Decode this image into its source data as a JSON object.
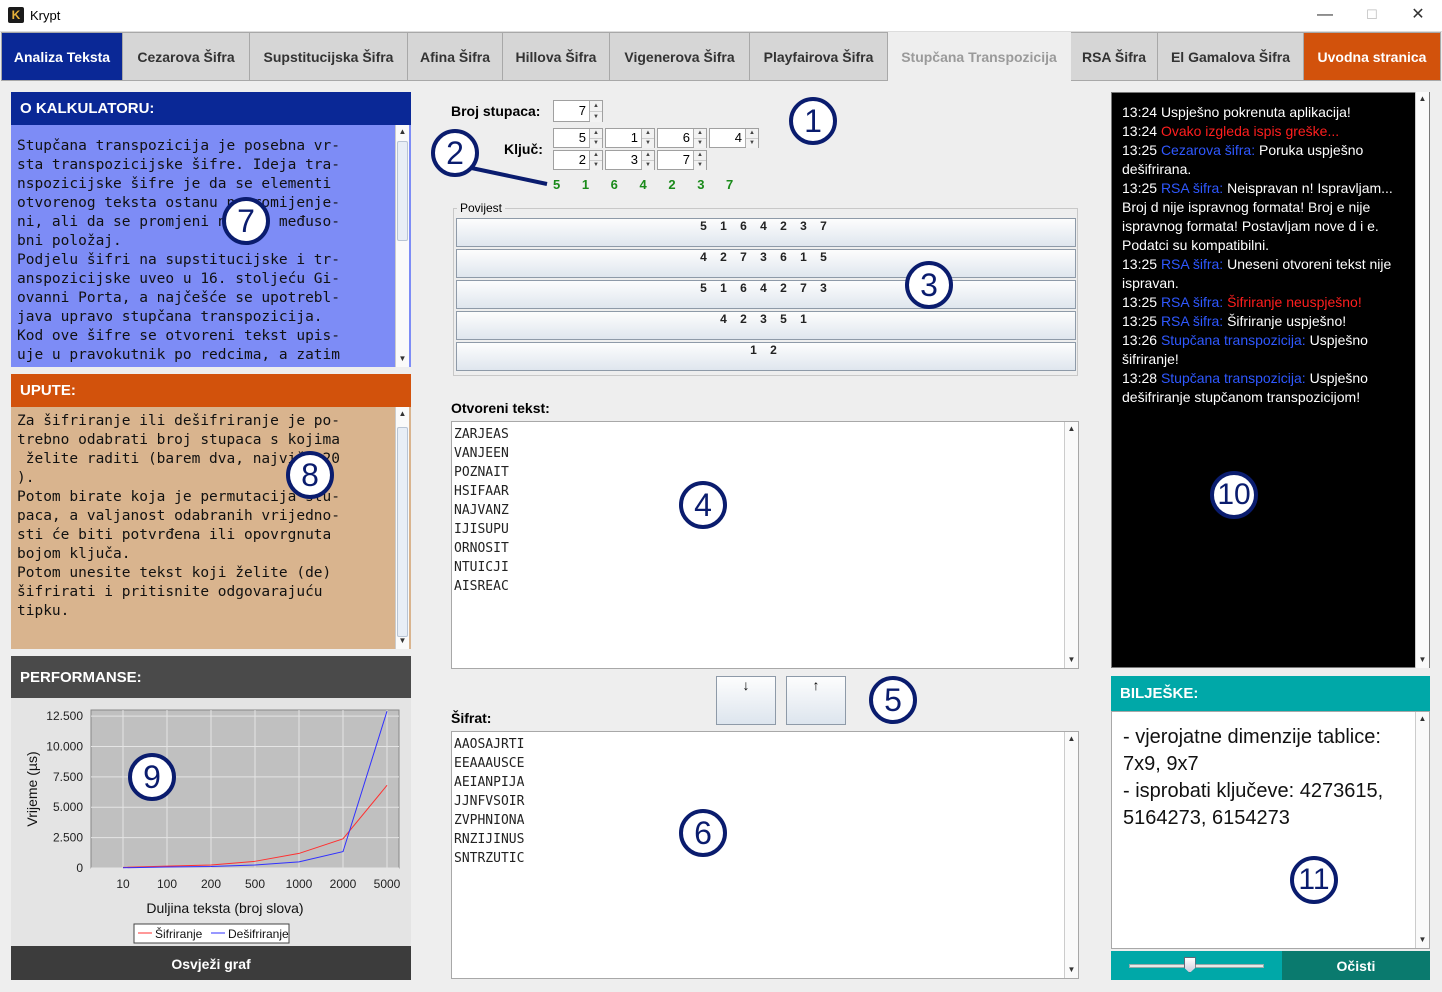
{
  "window": {
    "title": "Krypt",
    "icon_letter": "K",
    "minimize": "—",
    "maximize": "☐",
    "close": "✕"
  },
  "tabs": [
    {
      "label": "Analiza Teksta"
    },
    {
      "label": "Cezarova Šifra"
    },
    {
      "label": "Supstitucijska Šifra"
    },
    {
      "label": "Afina Šifra"
    },
    {
      "label": "Hillova Šifra"
    },
    {
      "label": "Vigenerova Šifra"
    },
    {
      "label": "Playfairova Šifra"
    },
    {
      "label": "Stupčana Transpozicija"
    },
    {
      "label": "RSA Šifra"
    },
    {
      "label": "El Gamalova Šifra"
    },
    {
      "label": "Uvodna stranica"
    }
  ],
  "colors": {
    "tab_first": "#0a2896",
    "tab_last": "#d2520c",
    "about": "#0a2896",
    "about_bg": "#7d8cf6",
    "instructions": "#d2520c",
    "instructions_bg": "#d9b48e",
    "performance": "#4a4a4a",
    "notes": "#00a8a8",
    "callout": "#0a1c6e",
    "success_key": "#1a8a1a"
  },
  "about": {
    "title": "O KALKULATORU:",
    "lines": [
      "Stupčana transpozicija je posebna vr-",
      "sta transpozicijske šifre. Ideja tra-",
      "nspozicijske šifre je da se elementi",
      "otvorenog teksta ostanu nepromijenje-",
      "ni, ali da se promjeni njihov međuso-",
      "bni položaj.",
      "Podjelu šifri na supstitucijske i tr-",
      "anspozicijske uveo u 16. stoljeću Gi-",
      "ovanni Porta, a najčešće se upotrebl-",
      "java upravo stupčana transpozicija.",
      "Kod ove šifre se otvoreni tekst upis-",
      "uje u pravokutnik po redcima, a zatim"
    ]
  },
  "instructions": {
    "title": "UPUTE:",
    "lines": [
      "Za šifriranje ili dešifriranje je po-",
      "trebno odabrati broj stupaca s kojima",
      " želite raditi (barem dva, najviše 20",
      ").",
      "Potom birate koja je permutacija stu-",
      "paca, a valjanost odabranih vrijedno-",
      "sti će biti potvrđena ili opovrgnuta",
      "bojom ključa.",
      "Potom unesite tekst koji želite (de)",
      "šifrirati i pritisnite odgovarajuću",
      "tipku."
    ]
  },
  "performance": {
    "title": "PERFORMANSE:",
    "refresh_button": "Osvježi graf"
  },
  "chart_data": {
    "type": "line",
    "categories": [
      "10",
      "100",
      "200",
      "500",
      "1000",
      "2000",
      "5000"
    ],
    "series": [
      {
        "name": "Šifriranje",
        "color": "#ff3030",
        "values": [
          50,
          150,
          250,
          550,
          1200,
          2400,
          6800
        ]
      },
      {
        "name": "Dešifriranje",
        "color": "#3030ff",
        "values": [
          20,
          80,
          120,
          250,
          500,
          1350,
          12900
        ]
      }
    ],
    "xlabel": "Duljina teksta (broj slova)",
    "ylabel": "Vrijeme (µs)",
    "ylim": [
      0,
      13000
    ],
    "yticks": [
      0,
      2500,
      5000,
      7500,
      10000,
      12500
    ],
    "ytick_labels": [
      "0",
      "2.500",
      "5.000",
      "7.500",
      "10.000",
      "12.500"
    ],
    "grid": true,
    "legend": "bottom"
  },
  "controls": {
    "columns_label": "Broj stupaca:",
    "columns_value": "7",
    "key_label": "Ključ:",
    "key_values": [
      "5",
      "1",
      "6",
      "4",
      "2",
      "3",
      "7"
    ],
    "key_preview": "5 1 6 4 2 3 7"
  },
  "history": {
    "title": "Povijest",
    "items": [
      "5 1 6 4 2 3 7",
      "4 2 7 3 6 1 5",
      "5 1 6 4 2 7 3",
      "4 2 3 5 1",
      "1 2"
    ]
  },
  "plaintext": {
    "label": "Otvoreni tekst:",
    "lines": [
      "ZARJEAS",
      "VANJEEN",
      "POZNAIT",
      "HSIFAAR",
      "NAJVANZ",
      "IJISUPU",
      "ORNOSIT",
      "NTUICJI",
      "AISREAC"
    ]
  },
  "actions": {
    "encrypt": "↓",
    "decrypt": "↑"
  },
  "ciphertext": {
    "label": "Šifrat:",
    "lines": [
      "AAOSAJRTI",
      "EEAAAUSCE",
      "AEIANPIJA",
      "JJNFVSOIR",
      "ZVPHNIONA",
      "RNZIJINUS",
      "SNTRZUTIC"
    ]
  },
  "log": {
    "entries": [
      {
        "time": "13:24",
        "source": "",
        "text": "Uspješno pokrenuta aplikacija!",
        "error": false,
        "cont": ""
      },
      {
        "time": "13:24",
        "source": "",
        "text": "Ovako izgleda ispis greške...",
        "error": true,
        "cont": ""
      },
      {
        "time": "13:25",
        "source": "Cezarova šifra:",
        "text": "Poruka uspješno",
        "error": false,
        "cont": "dešifrirana."
      },
      {
        "time": "13:25",
        "source": "RSA šifra:",
        "text": "Neispravan n! Ispravljam...",
        "error": false,
        "cont": "Broj d nije ispravnog formata! Broj e nije ispravnog formata! Postavljam nove d i e. Podatci su kompatibilni."
      },
      {
        "time": "13:25",
        "source": "RSA šifra:",
        "text": "Uneseni otvoreni tekst nije",
        "error": false,
        "cont": "ispravan."
      },
      {
        "time": "13:25",
        "source": "RSA šifra:",
        "text": "Šifriranje neuspješno!",
        "error": true,
        "cont": ""
      },
      {
        "time": "13:25",
        "source": "RSA šifra:",
        "text": "Šifriranje uspješno!",
        "error": false,
        "cont": ""
      },
      {
        "time": "13:26",
        "source": "Stupčana transpozicija:",
        "text": "Uspješno",
        "error": false,
        "cont": "šifriranje!"
      },
      {
        "time": "13:28",
        "source": "Stupčana transpozicija:",
        "text": "Uspješno",
        "error": false,
        "cont": "dešifriranje stupčanom transpozicijom!"
      }
    ]
  },
  "notes": {
    "title": "BILJEŠKE:",
    "lines": [
      "- vjerojatne dimenzije tablice:",
      "7x9, 9x7",
      "- isprobati ključeve: 4273615,",
      "5164273, 6154273"
    ],
    "clear_button": "Očisti",
    "slider_value": 0.45
  },
  "callouts": [
    "1",
    "2",
    "3",
    "4",
    "5",
    "6",
    "7",
    "8",
    "9",
    "10",
    "11"
  ]
}
